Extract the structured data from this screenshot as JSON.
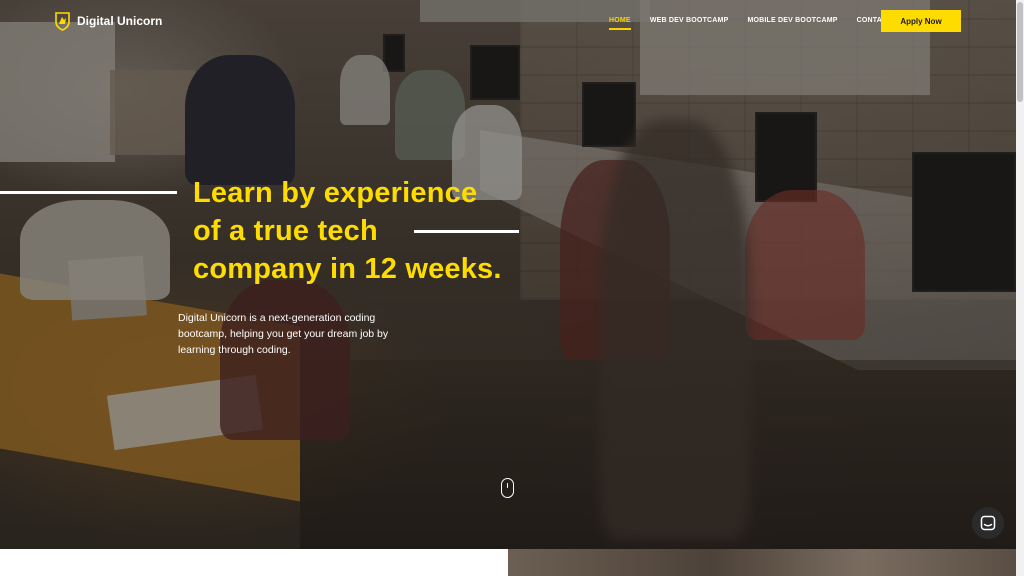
{
  "brand": {
    "name": "Digital Unicorn",
    "logo_icon": "unicorn-shield-icon",
    "accent": "#ffdc00"
  },
  "nav": {
    "items": [
      {
        "label": "HOME",
        "active": true
      },
      {
        "label": "WEB DEV BOOTCAMP",
        "active": false
      },
      {
        "label": "MOBILE DEV BOOTCAMP",
        "active": false
      },
      {
        "label": "CONTACTS",
        "active": false
      }
    ],
    "cta_label": "Apply Now"
  },
  "hero": {
    "headline_lines": [
      "Learn by experience",
      "of a true tech",
      "company in 12 weeks."
    ],
    "subtext": "Digital Unicorn is a next-generation coding bootcamp, helping you get your dream job by learning through coding.",
    "scroll_icon": "mouse-scroll-icon"
  },
  "chat": {
    "icon": "chat-bubble-icon"
  }
}
